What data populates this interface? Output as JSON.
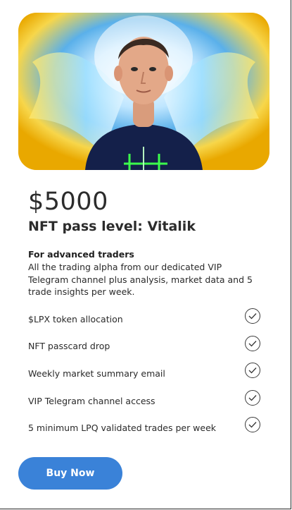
{
  "card": {
    "price": "$5000",
    "title": "NFT pass level: Vitalik",
    "subtitle": "For advanced traders",
    "description": "All the trading alpha from our dedicated VIP Telegram channel plus analysis, market data and 5 trade insights per week.",
    "features": [
      {
        "label": "$LPX token allocation",
        "icon": "check-circle-icon"
      },
      {
        "label": "NFT passcard drop",
        "icon": "check-circle-icon"
      },
      {
        "label": "Weekly market summary email",
        "icon": "check-circle-icon"
      },
      {
        "label": "VIP Telegram channel access",
        "icon": "check-circle-icon"
      },
      {
        "label": "5 minimum LPQ validated trades per week",
        "icon": "check-circle-icon"
      }
    ],
    "buy_label": "Buy Now"
  },
  "colors": {
    "button": "#3a82d8",
    "text": "#2c2c2c",
    "hero_blue": "#58aee8",
    "hero_yellow": "#f2b600"
  }
}
